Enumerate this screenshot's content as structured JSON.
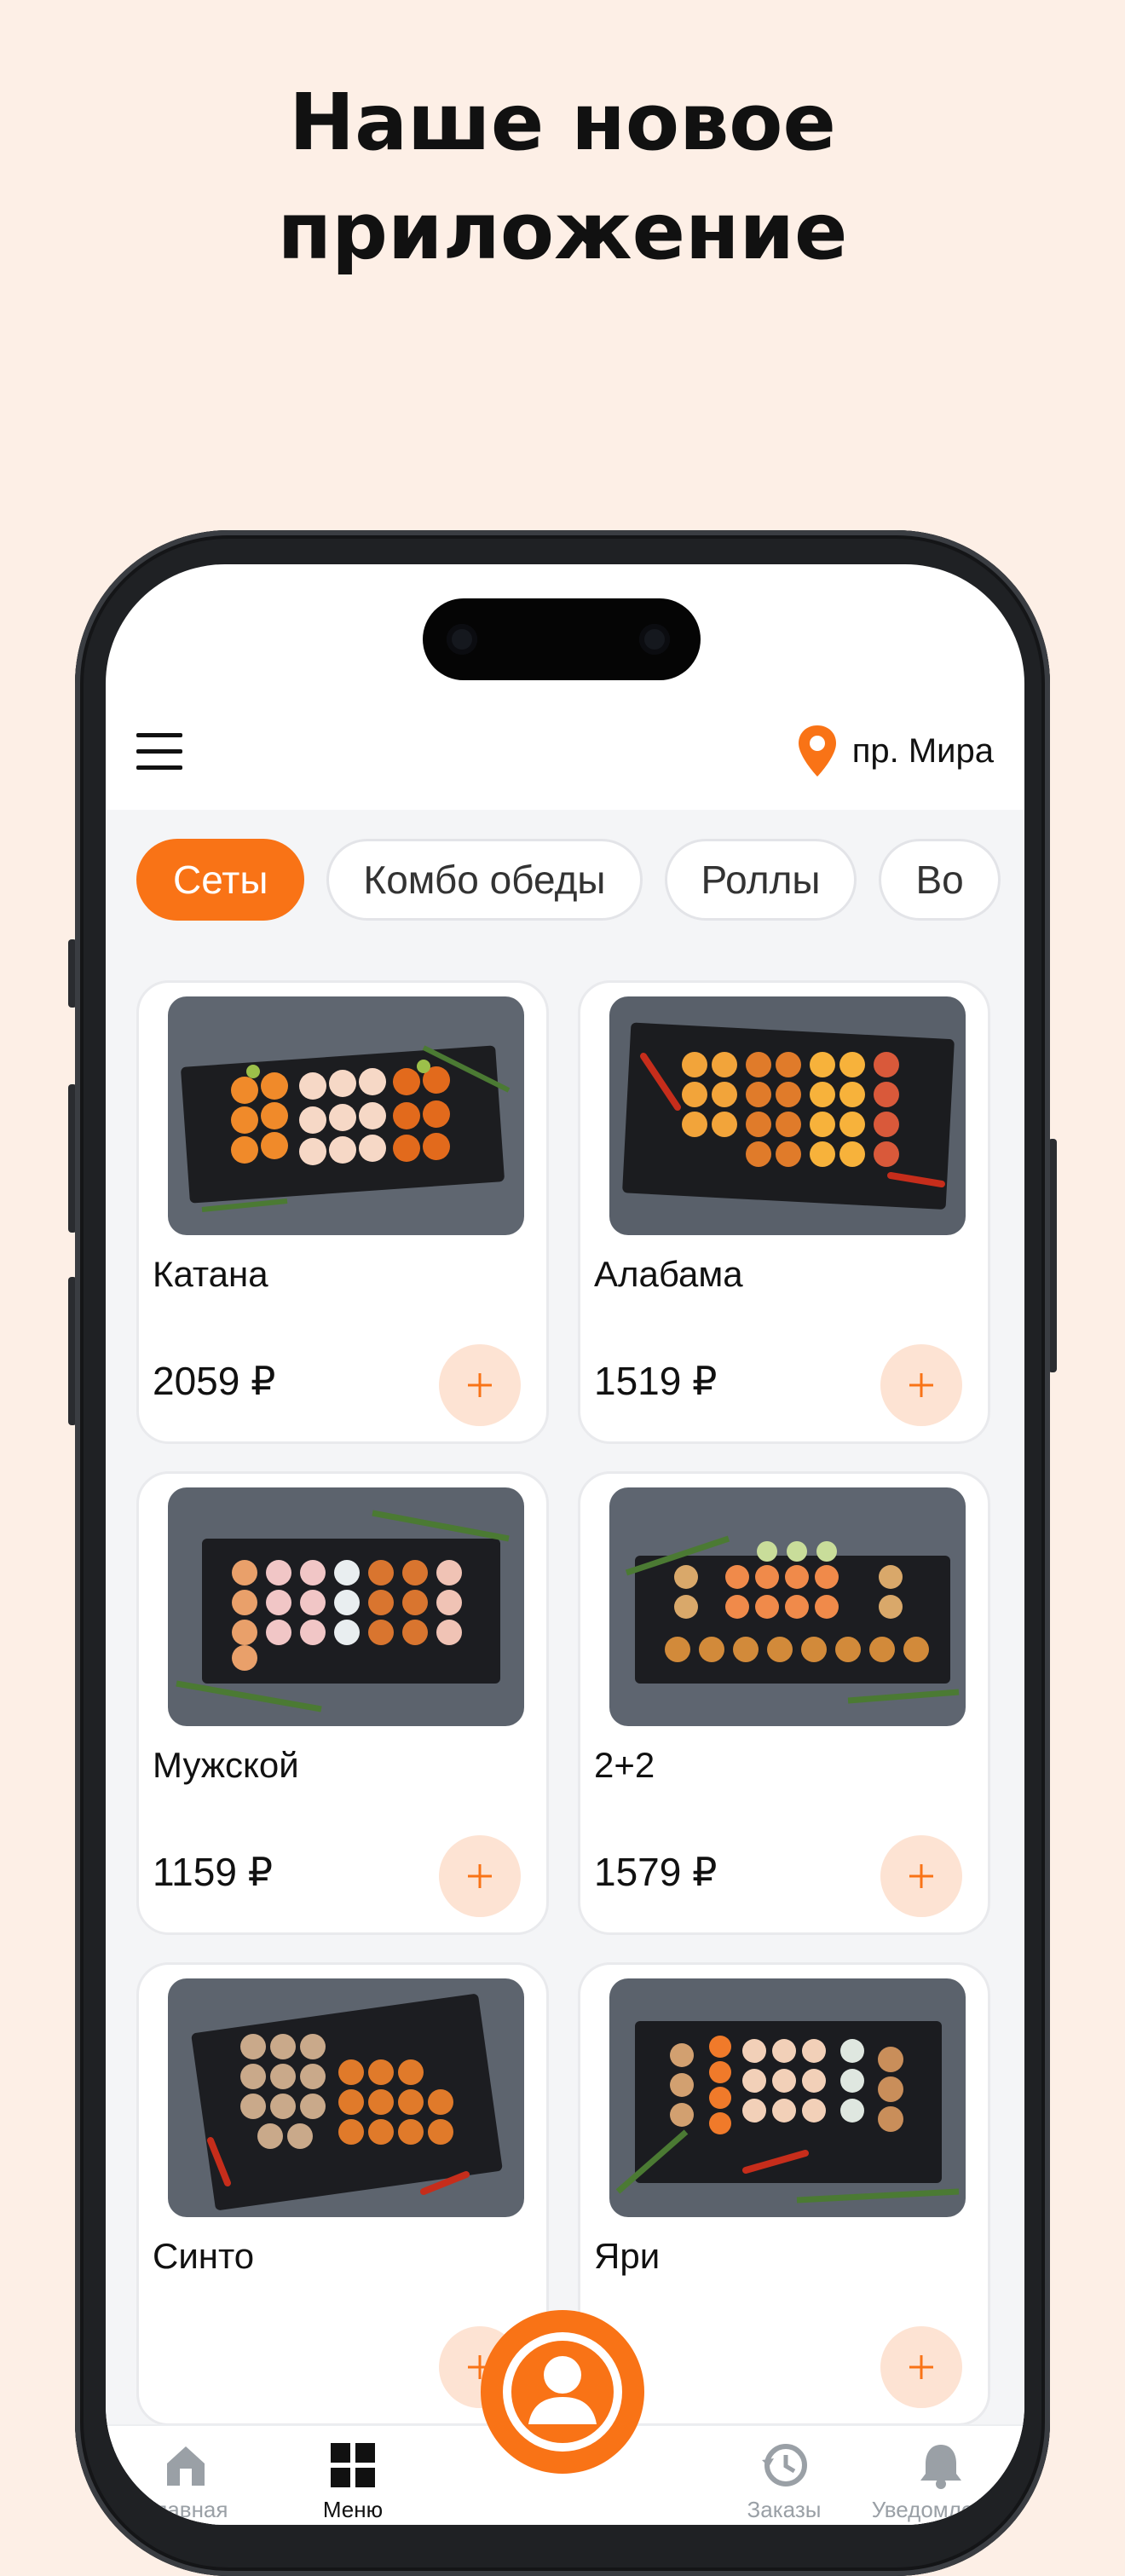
{
  "headline": {
    "line1": "Наше новое",
    "line2": "приложение"
  },
  "header": {
    "location": "пр. Мира"
  },
  "categories": [
    {
      "label": "Сеты",
      "active": true
    },
    {
      "label": "Комбо обеды",
      "active": false
    },
    {
      "label": "Роллы",
      "active": false
    },
    {
      "label": "Во",
      "active": false
    }
  ],
  "products": [
    {
      "name": "Катана",
      "price": "2059 ₽"
    },
    {
      "name": "Алабама",
      "price": "1519 ₽"
    },
    {
      "name": "Мужской",
      "price": "1159 ₽"
    },
    {
      "name": "2+2",
      "price": "1579 ₽"
    },
    {
      "name": "Синто",
      "price": ""
    },
    {
      "name": "Яри",
      "price": ""
    }
  ],
  "nav": {
    "home": "Главная",
    "menu": "Меню",
    "orders": "Заказы",
    "notifications": "Уведомления"
  },
  "colors": {
    "accent": "#f97316",
    "accent_soft": "#fde3d3",
    "page_bg": "#fdefe6"
  },
  "icons": [
    "burger-menu-icon",
    "location-pin-icon",
    "plus-icon",
    "home-icon",
    "grid-icon",
    "user-icon",
    "history-icon",
    "bell-icon"
  ]
}
